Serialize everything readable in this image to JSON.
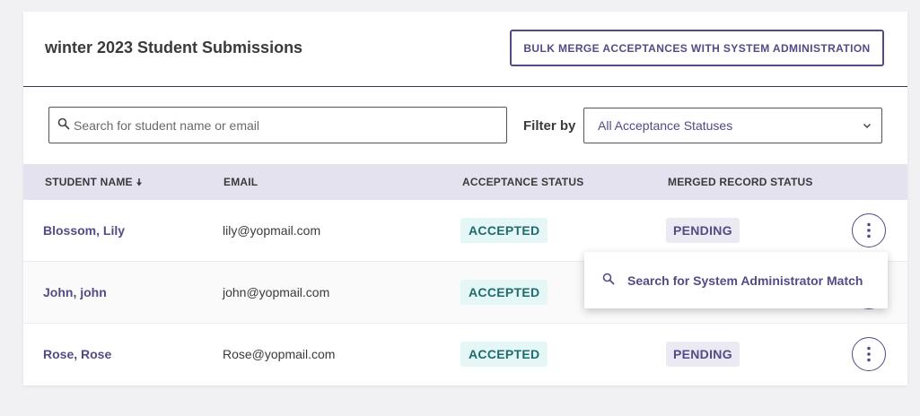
{
  "header": {
    "title": "winter 2023 Student Submissions",
    "bulk_button_label": "BULK MERGE ACCEPTANCES WITH SYSTEM ADMINISTRATION"
  },
  "search": {
    "placeholder": "Search for student name or email",
    "value": ""
  },
  "filter": {
    "label": "Filter by",
    "selected": "All Acceptance Statuses"
  },
  "table": {
    "columns": {
      "student_name": "STUDENT NAME",
      "email": "EMAIL",
      "acceptance_status": "ACCEPTANCE STATUS",
      "merged_record_status": "MERGED RECORD STATUS"
    },
    "sort": {
      "column": "student_name",
      "direction": "descending"
    },
    "rows": [
      {
        "name": "Blossom, Lily",
        "email": "lily@yopmail.com",
        "acceptance": "ACCEPTED",
        "merged": "PENDING"
      },
      {
        "name": "John, john",
        "email": "john@yopmail.com",
        "acceptance": "ACCEPTED",
        "merged": ""
      },
      {
        "name": "Rose, Rose",
        "email": "Rose@yopmail.com",
        "acceptance": "ACCEPTED",
        "merged": "PENDING"
      }
    ]
  },
  "row_menu": {
    "open_for_row": 0,
    "items": [
      {
        "label": "Search for System Administrator Match",
        "icon": "search-icon"
      }
    ]
  },
  "colors": {
    "brand": "#554a85",
    "header_bg": "#e4e2ef",
    "accepted_bg": "#e4f6f6",
    "accepted_text": "#1f6b6e",
    "pending_bg": "#ebe9f2"
  }
}
